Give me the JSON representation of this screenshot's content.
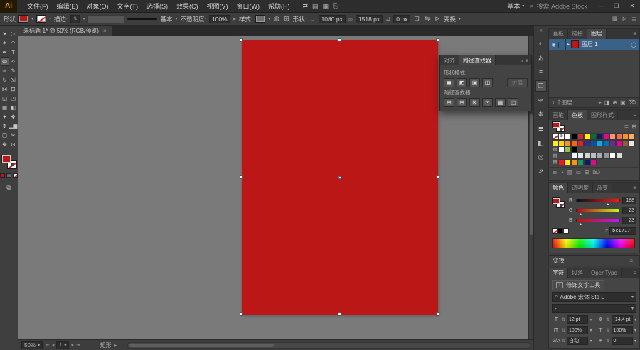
{
  "ui": {
    "caret": "▾",
    "stepper": "⇅",
    "menu": "≡",
    "collapse": "«",
    "expand_left": "»",
    "chain": "∞",
    "width_icon": "↔",
    "radius_icon": "⊿",
    "search_icon": "⌕",
    "arrow_right": "▸",
    "nav_first": "⇤",
    "nav_prev": "◂",
    "nav_next": "▸",
    "nav_last": "⇥"
  },
  "titlebar": {
    "logo": "Ai",
    "menus": [
      "文件(F)",
      "编辑(E)",
      "对象(O)",
      "文字(T)",
      "选择(S)",
      "效果(C)",
      "视图(V)",
      "窗口(W)",
      "帮助(H)"
    ],
    "tool_icons": [
      {
        "name": "bridge-icon",
        "glyph": "⇄"
      },
      {
        "name": "stock-icon",
        "glyph": "▤"
      },
      {
        "name": "arrange-documents-icon",
        "glyph": "▦"
      },
      {
        "name": "share-icon",
        "glyph": "⎘"
      }
    ],
    "workspace_label": "基本",
    "search_label": "搜索 Adobe Stock",
    "window_controls": {
      "minimize": "—",
      "maximize": "❐",
      "close": "✕"
    }
  },
  "options_bar": {
    "context_label": "形状",
    "stroke_weight_label": "描边:",
    "brush_style": "基本",
    "opacity_label": "不透明度:",
    "opacity_value": "100%",
    "style_label": "样式:",
    "recolor_icon": "◍",
    "grid_icon": "⊞",
    "shape_label": "形状:",
    "width_value": "1080 px",
    "height_value": "1518 px",
    "radius_value": "0 px",
    "transform_label": "变换",
    "extra_icons": [
      {
        "name": "pixel-grid-icon",
        "glyph": "⊡"
      },
      {
        "name": "flip-icon",
        "glyph": "⇋"
      },
      {
        "name": "isolate-icon",
        "glyph": "⊳"
      }
    ],
    "right_icons": [
      {
        "name": "align-glyph-icon",
        "glyph": "▦"
      },
      {
        "name": "panel-arrow-icon",
        "glyph": "⊳"
      },
      {
        "name": "control-menu-icon",
        "glyph": "≣"
      }
    ]
  },
  "toolbar": {
    "tools": [
      {
        "name": "selection-tool",
        "glyph": "➤"
      },
      {
        "name": "direct-selection-tool",
        "glyph": "▷"
      },
      {
        "name": "magic-wand-tool",
        "glyph": "✶"
      },
      {
        "name": "lasso-tool",
        "glyph": "◠"
      },
      {
        "name": "pen-tool",
        "glyph": "✒"
      },
      {
        "name": "type-tool",
        "glyph": "T"
      },
      {
        "name": "rectangle-tool",
        "glyph": "▭",
        "selected": true
      },
      {
        "name": "shaper-tool",
        "glyph": "✧"
      },
      {
        "name": "paintbrush-tool",
        "glyph": "✑"
      },
      {
        "name": "pencil-tool",
        "glyph": "✎"
      },
      {
        "name": "rotate-tool",
        "glyph": "↻"
      },
      {
        "name": "scale-tool",
        "glyph": "⇲"
      },
      {
        "name": "width-tool",
        "glyph": "⋈"
      },
      {
        "name": "free-transform-tool",
        "glyph": "⊡"
      },
      {
        "name": "shape-builder-tool",
        "glyph": "◱"
      },
      {
        "name": "perspective-grid-tool",
        "glyph": "◳"
      },
      {
        "name": "mesh-tool",
        "glyph": "▦"
      },
      {
        "name": "gradient-tool",
        "glyph": "◧"
      },
      {
        "name": "eyedropper-tool",
        "glyph": "✦"
      },
      {
        "name": "blend-tool",
        "glyph": "❖"
      },
      {
        "name": "symbol-sprayer-tool",
        "glyph": "❉"
      },
      {
        "name": "column-graph-tool",
        "glyph": "▂▆"
      },
      {
        "name": "artboard-tool",
        "glyph": "▢"
      },
      {
        "name": "slice-tool",
        "glyph": "✂"
      },
      {
        "name": "hand-tool",
        "glyph": "✥"
      },
      {
        "name": "zoom-tool",
        "glyph": "⊙"
      }
    ],
    "mode_buttons": [
      {
        "name": "color-mode-button",
        "glyph": ""
      },
      {
        "name": "gradient-mode-button",
        "glyph": "▥"
      },
      {
        "name": "none-mode-button",
        "glyph": ""
      }
    ],
    "screen_mode_icon": "⧉"
  },
  "document": {
    "tab_title": "未标题-1* @ 50% (RGB/预览)",
    "tab_close": "×"
  },
  "artwork": {
    "fill_color": "#bc1717"
  },
  "pathfinder": {
    "tabs": [
      {
        "label": "对齐"
      },
      {
        "label": "路径查找器",
        "active": true
      }
    ],
    "shape_modes_label": "形状模式:",
    "shape_mode_buttons": [
      {
        "name": "unite-button",
        "glyph": "◼"
      },
      {
        "name": "minus-front-button",
        "glyph": "◩"
      },
      {
        "name": "intersect-button",
        "glyph": "▣"
      },
      {
        "name": "exclude-button",
        "glyph": "◫"
      }
    ],
    "expand_label": "扩展",
    "pathfinders_label": "路径查找器:",
    "pathfinder_buttons": [
      {
        "name": "divide-button",
        "glyph": "⊞"
      },
      {
        "name": "trim-button",
        "glyph": "⊟"
      },
      {
        "name": "merge-button",
        "glyph": "⊠"
      },
      {
        "name": "crop-button",
        "glyph": "⊡"
      },
      {
        "name": "outline-button",
        "glyph": "▦"
      },
      {
        "name": "minus-back-button",
        "glyph": "◰"
      }
    ]
  },
  "dock": {
    "icons": [
      {
        "name": "color-panel-icon",
        "glyph": "◐"
      },
      {
        "name": "color-guide-panel-icon",
        "glyph": "◭"
      },
      {
        "name": "align-panel-icon",
        "glyph": "≡"
      },
      {
        "name": "pathfinder-panel-icon",
        "glyph": "❒",
        "active": true
      },
      {
        "name": "brushes-panel-icon",
        "glyph": "✑"
      },
      {
        "name": "symbols-panel-icon",
        "glyph": "❉"
      },
      {
        "name": "stroke-panel-icon",
        "glyph": "≣"
      },
      {
        "name": "gradient-panel-icon",
        "glyph": "◧"
      },
      {
        "name": "appearance-panel-icon",
        "glyph": "◎"
      },
      {
        "name": "asset-export-panel-icon",
        "glyph": "⇗"
      }
    ]
  },
  "layers_panel": {
    "tabs": [
      {
        "label": "画板"
      },
      {
        "label": "链接"
      },
      {
        "label": "图层",
        "active": true
      }
    ],
    "layer_name": "图层 1",
    "eye_icon": "◉",
    "target_icon": "◯",
    "count_label": "1 个图层",
    "bottom_icons": [
      {
        "name": "locate-object-icon",
        "glyph": "⌖"
      },
      {
        "name": "make-mask-icon",
        "glyph": "◨"
      },
      {
        "name": "new-sublayer-icon",
        "glyph": "⊕"
      },
      {
        "name": "new-layer-icon",
        "glyph": "▣"
      },
      {
        "name": "delete-layer-icon",
        "glyph": "⌦"
      }
    ]
  },
  "swatches_panel": {
    "tabs": [
      {
        "label": "画笔"
      },
      {
        "label": "色板",
        "active": true
      },
      {
        "label": "图形样式"
      }
    ],
    "view_icons": [
      {
        "name": "list-view-icon",
        "glyph": "≣"
      },
      {
        "name": "grid-view-icon",
        "glyph": "⊞"
      }
    ],
    "grid": [
      "none",
      "reg",
      "#ffffff",
      "#000000",
      "#ed1c24",
      "#fff200",
      "#007236",
      "#1b1464",
      "#ec008c",
      "#f69679",
      "#f26c4f",
      "#f7941e",
      "#fbaf5d",
      "#fff200",
      "#ffd400",
      "#f7941e",
      "#f26522",
      "#ed1c24",
      "#2e3192",
      "#0054a6",
      "#00aeef",
      "#0072bc",
      "#662d91",
      "#ec008c",
      "#8a5d3b",
      "#e6e7e8",
      "folder",
      "#ffffff",
      "#8dc63f",
      "#000000",
      "gap",
      "gap",
      "gap",
      "gap",
      "gap",
      "gap",
      "gap",
      "gap",
      "gap",
      "folder",
      "gap",
      "gap",
      "#f1f2f2",
      "#e6e7e8",
      "#d1d3d4",
      "#bcbec0",
      "#a7a9ac",
      "#939598",
      "#ffffff",
      "#dddddd",
      "gap",
      "gap",
      "folder",
      "#ed1c24",
      "#fff200",
      "#f7941e",
      "#00a651",
      "#1b1464",
      "#ec008c",
      "gap",
      "gap",
      "gap",
      "gap",
      "gap",
      "gap"
    ],
    "bottom_icons": [
      {
        "name": "swatch-libraries-icon",
        "glyph": "≣"
      },
      {
        "name": "color-themes-icon",
        "glyph": "◔"
      },
      {
        "name": "swatch-kinds-icon",
        "glyph": "▤"
      },
      {
        "name": "new-color-group-icon",
        "glyph": "▭"
      },
      {
        "name": "new-swatch-icon",
        "glyph": "⊞"
      },
      {
        "name": "delete-swatch-icon",
        "glyph": "⌦"
      }
    ]
  },
  "color_panel": {
    "tabs": [
      {
        "label": "颜色",
        "active": true
      },
      {
        "label": "透明度"
      },
      {
        "label": "渐变"
      }
    ],
    "sliders": [
      {
        "label": "R",
        "value": "188"
      },
      {
        "label": "G",
        "value": "23"
      },
      {
        "label": "B",
        "value": "23"
      }
    ],
    "hex_prefix": "#",
    "hex_value": "bc1717"
  },
  "transform_bar": {
    "label": "变换"
  },
  "character_panel": {
    "tabs": [
      {
        "label": "字符",
        "active": true
      },
      {
        "label": "段落"
      },
      {
        "label": "OpenType"
      }
    ],
    "touch_type_icon": "T",
    "touch_type_label": "修饰文字工具",
    "font_name": "Adobe 宋体 Std L",
    "font_style": "-",
    "size_icon": "T",
    "size_value": "12 pt",
    "leading_icon": "⇕",
    "leading_value": "(14.4 pt",
    "vscale_icon": "IT",
    "vscale_value": "100%",
    "hscale_icon": "工",
    "hscale_value": "100%",
    "kerning_icon": "V/A",
    "kerning_value": "自动",
    "tracking_icon": "⇹",
    "tracking_value": "0"
  },
  "status_bar": {
    "zoom_value": "50%",
    "artboard_value": "1",
    "status_text": "矩形"
  }
}
